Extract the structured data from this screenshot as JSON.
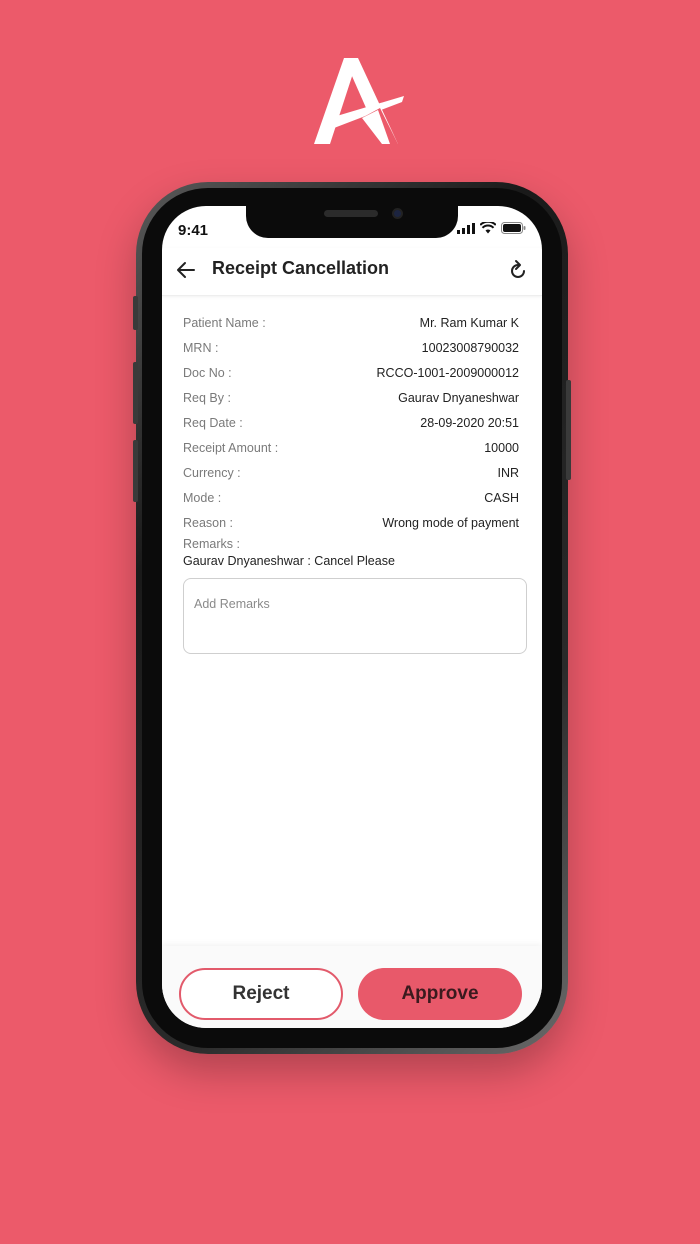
{
  "brand": {
    "logo_icon": "brand-a-logo-icon",
    "background_color": "#ec5a6a",
    "accent_color": "#e8596a"
  },
  "status_bar": {
    "time": "9:41",
    "icons": [
      "signal-icon",
      "wifi-icon",
      "battery-icon"
    ]
  },
  "appbar": {
    "title": "Receipt Cancellation",
    "back_icon": "back-arrow-icon",
    "refresh_icon": "refresh-icon"
  },
  "details": [
    {
      "label": "Patient Name :",
      "value": "Mr. Ram Kumar K"
    },
    {
      "label": "MRN :",
      "value": "10023008790032"
    },
    {
      "label": "Doc No :",
      "value": "RCCO-1001-2009000012"
    },
    {
      "label": "Req By :",
      "value": "Gaurav Dnyaneshwar"
    },
    {
      "label": "Req Date :",
      "value": "28-09-2020 20:51"
    },
    {
      "label": "Receipt Amount :",
      "value": "10000"
    },
    {
      "label": "Currency :",
      "value": "INR"
    },
    {
      "label": "Mode :",
      "value": "CASH"
    },
    {
      "label": "Reason :",
      "value": "Wrong mode of payment"
    }
  ],
  "remarks": {
    "label": "Remarks :",
    "text": "Gaurav Dnyaneshwar : Cancel Please",
    "input_placeholder": "Add Remarks",
    "input_value": ""
  },
  "actions": {
    "reject_label": "Reject",
    "approve_label": "Approve"
  }
}
